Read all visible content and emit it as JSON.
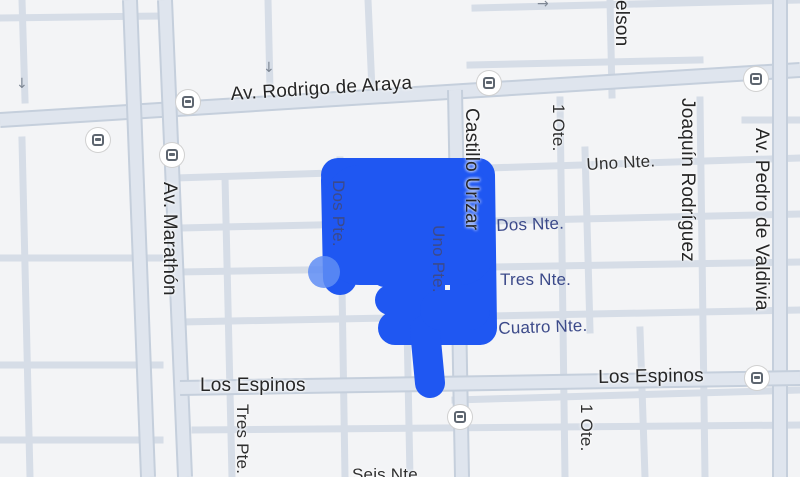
{
  "streets": {
    "rodrigo_de_araya": "Av. Rodrigo de Araya",
    "marathon": "Av. Marathón",
    "pedro_de_valdivia": "Av. Pedro de Valdivia",
    "los_espinos_west": "Los Espinos",
    "los_espinos_east": "Los Espinos",
    "castillo_urizar": "Castillo Urízar",
    "joaquin_rodriguez": "Joaquín Rodríguez",
    "nelson": "elson",
    "uno_nte": "Uno Nte.",
    "dos_nte": "Dos Nte.",
    "tres_nte": "Tres Nte.",
    "cuatro_nte": "Cuatro Nte.",
    "dos_pte": "Dos Pte.",
    "uno_pte": "Uno Pte.",
    "tres_pte": "Tres Pte.",
    "uno_ote_north": "1 Ote.",
    "uno_ote_south": "1 Ote.",
    "seis_nte": "Seis Nte."
  },
  "icons": {
    "bus_stop": "bus-stop-icon",
    "one_way_arrow": "down-arrow-icon"
  },
  "colors": {
    "route": "#1f57f2",
    "background": "#f3f4f6",
    "road": "#d6dde7"
  }
}
